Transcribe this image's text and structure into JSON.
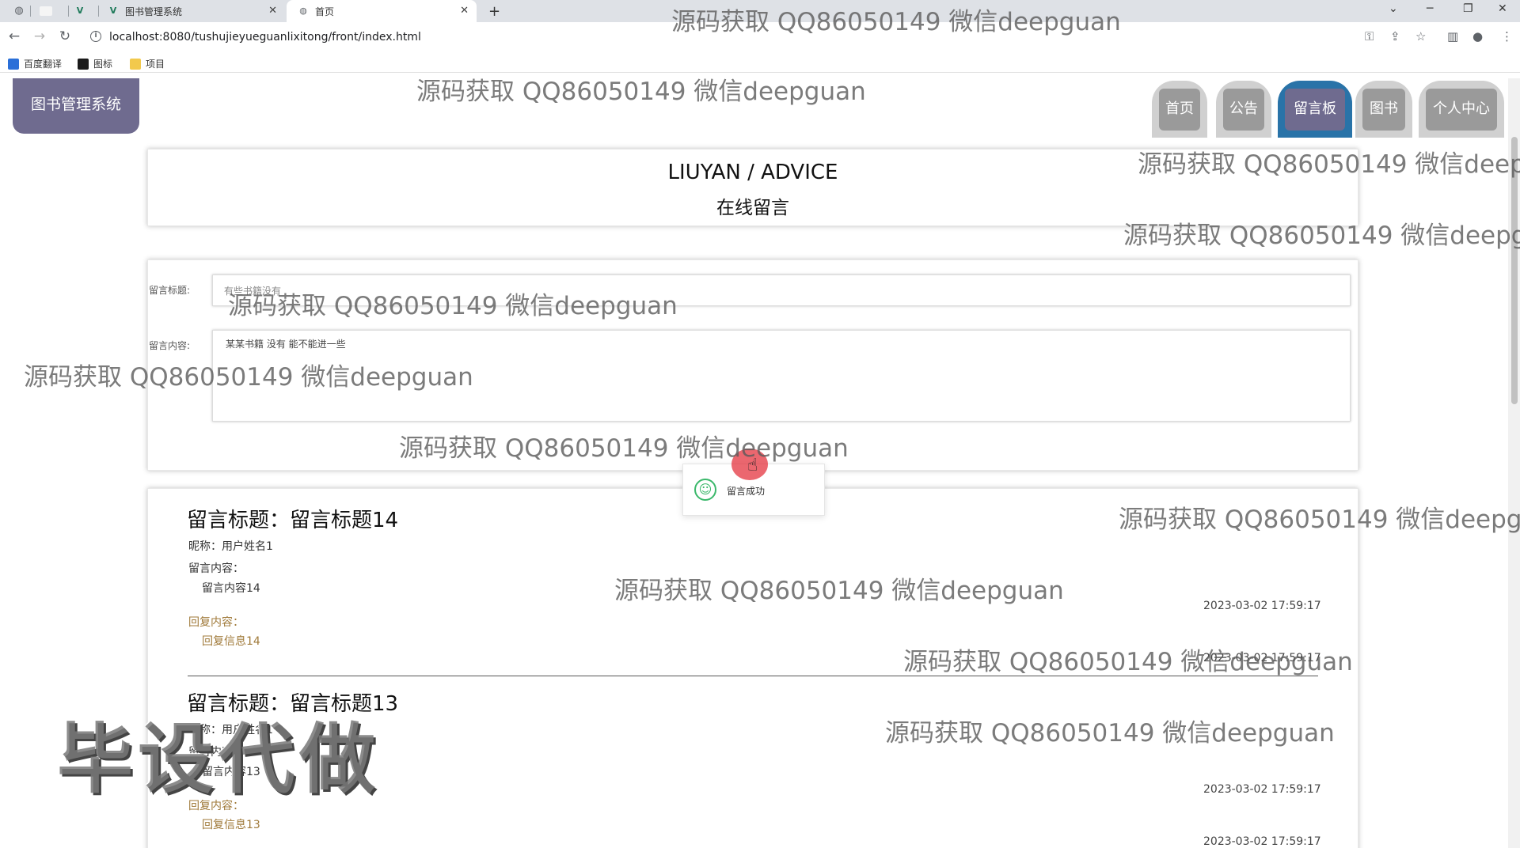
{
  "browser": {
    "tabs": [
      {
        "title": ""
      },
      {
        "title": "图书管理系统"
      },
      {
        "title": "首页"
      }
    ],
    "new_tab": "+",
    "url": "localhost:8080/tushujieyueguanlixitong/front/index.html",
    "bookmarks": [
      "百度翻译",
      "图标",
      "项目"
    ]
  },
  "site": {
    "logo": "图书管理系统",
    "nav": [
      "首页",
      "公告",
      "留言板",
      "图书",
      "个人中心"
    ],
    "active_nav": "留言板"
  },
  "header": {
    "title_en": "LIUYAN / ADVICE",
    "title_cn": "在线留言"
  },
  "form": {
    "title_label": "留言标题:",
    "title_value": "有些书籍没有",
    "content_label": "留言内容:",
    "content_value": "某某书籍 没有 能不能进一些"
  },
  "toast": {
    "message": "留言成功"
  },
  "messages": [
    {
      "title": "留言标题：留言标题14",
      "nickname": "昵称：用户姓名1",
      "content_label": "留言内容：",
      "content": "留言内容14",
      "time": "2023-03-02 17:59:17",
      "reply_label": "回复内容：",
      "reply": "回复信息14",
      "reply_time": "2023-03-02 17:59:17"
    },
    {
      "title": "留言标题：留言标题13",
      "nickname": "昵称：用户姓名1",
      "content_label": "留言内容：",
      "content": "留言内容13",
      "time": "2023-03-02 17:59:17",
      "reply_label": "回复内容：",
      "reply": "回复信息13",
      "reply_time": "2023-03-02 17:59:17"
    }
  ],
  "watermarks": {
    "text": "源码获取 QQ86050149 微信deepguan",
    "stamp": "毕设代做"
  },
  "colors": {
    "accent": "#6f6b8f",
    "active_ring": "#2973a8",
    "reply": "#a07a3a",
    "toast_icon": "#3bb86b"
  }
}
